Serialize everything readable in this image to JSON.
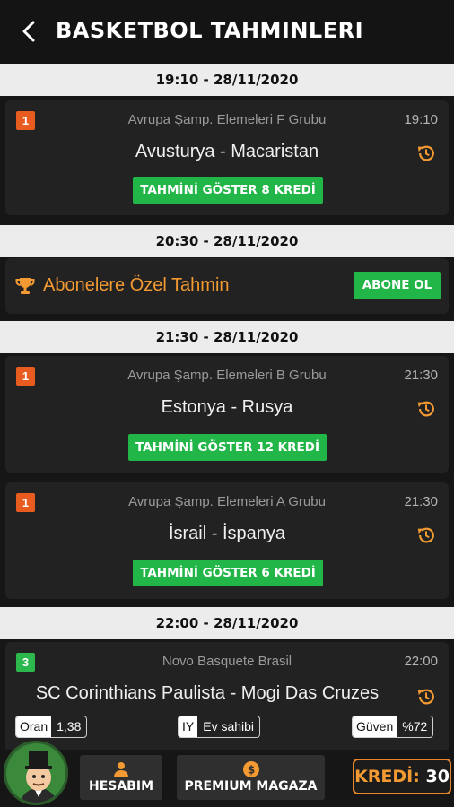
{
  "header": {
    "title": "BASKETBOL TAHMINLERI",
    "back_icon": "chevron-left-icon"
  },
  "colors": {
    "accent_orange": "#f39a32",
    "green": "#22b547",
    "rank_orange": "#e85d1f",
    "rank_green": "#2db84d"
  },
  "date_headers": [
    "19:10 - 28/11/2020",
    "20:30 - 28/11/2020",
    "21:30 - 28/11/2020",
    "22:00 - 28/11/2020"
  ],
  "matches": [
    {
      "rank": "1",
      "league": "Avrupa Şamp. Elemeleri F Grubu",
      "time": "19:10",
      "teams": "Avusturya - Macaristan",
      "button": "TAHMİNİ GÖSTER 8 KREDİ"
    },
    {
      "rank": "1",
      "league": "Avrupa Şamp. Elemeleri B Grubu",
      "time": "21:30",
      "teams": "Estonya - Rusya",
      "button": "TAHMİNİ GÖSTER 12 KREDİ"
    },
    {
      "rank": "1",
      "league": "Avrupa Şamp. Elemeleri A Grubu",
      "time": "21:30",
      "teams": "İsrail - İspanya",
      "button": "TAHMİNİ GÖSTER 6 KREDİ"
    },
    {
      "rank": "3",
      "league": "Novo Basquete Brasil",
      "time": "22:00",
      "teams": "SC Corinthians Paulista - Mogi Das Cruzes",
      "pills": {
        "oran_label": "Oran",
        "oran_value": "1,38",
        "iy_label": "IY",
        "iy_value": "Ev sahibi",
        "guven_label": "Güven",
        "guven_value": "%72"
      }
    }
  ],
  "subscriber": {
    "label": "Abonelere Özel Tahmin",
    "button": "ABONE OL"
  },
  "bottom_nav": {
    "account": "HESABIM",
    "store": "PREMIUM MAGAZA",
    "credit_label": "KREDİ:",
    "credit_value": "30"
  }
}
